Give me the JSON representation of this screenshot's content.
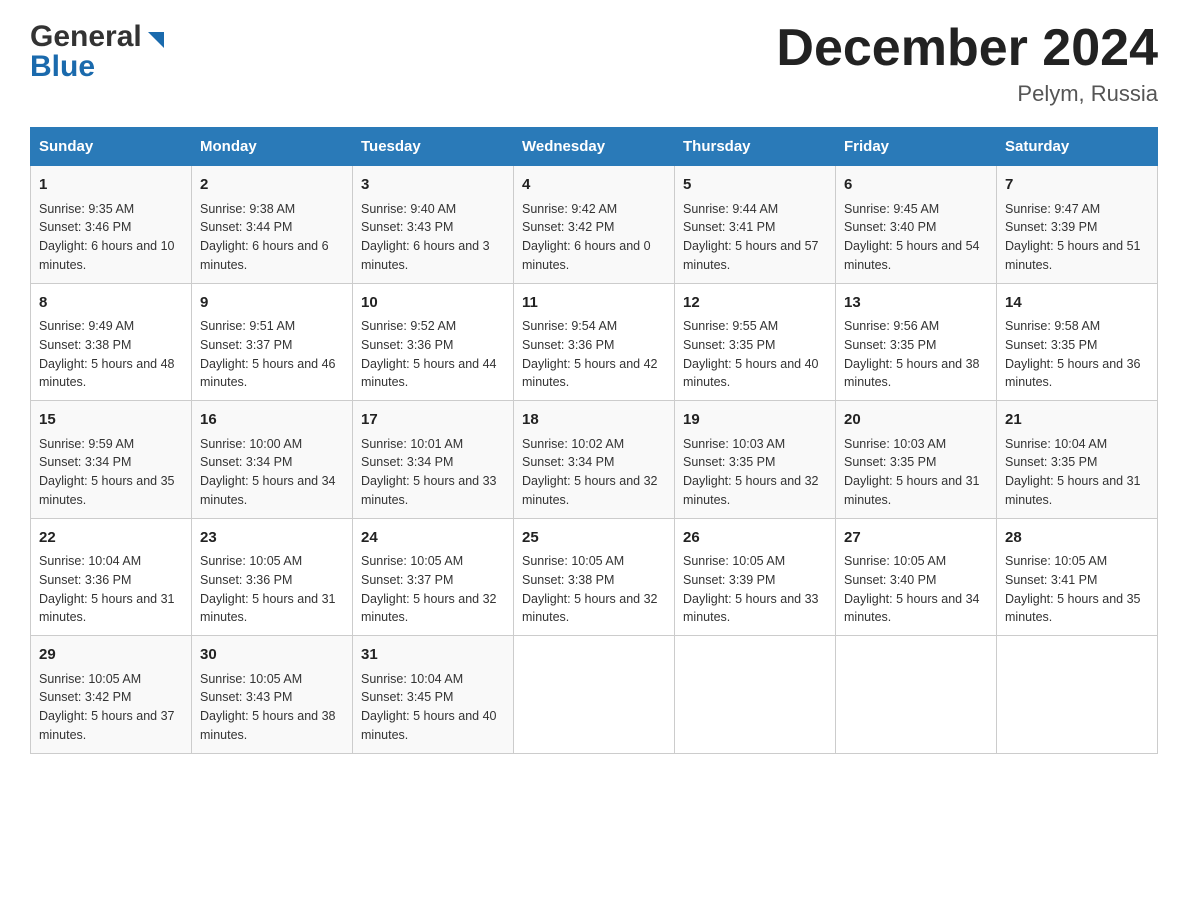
{
  "header": {
    "logo_general": "General",
    "logo_blue": "Blue",
    "month_title": "December 2024",
    "location": "Pelym, Russia"
  },
  "days_of_week": [
    "Sunday",
    "Monday",
    "Tuesday",
    "Wednesday",
    "Thursday",
    "Friday",
    "Saturday"
  ],
  "weeks": [
    [
      {
        "day": "1",
        "sunrise": "9:35 AM",
        "sunset": "3:46 PM",
        "daylight": "6 hours and 10 minutes."
      },
      {
        "day": "2",
        "sunrise": "9:38 AM",
        "sunset": "3:44 PM",
        "daylight": "6 hours and 6 minutes."
      },
      {
        "day": "3",
        "sunrise": "9:40 AM",
        "sunset": "3:43 PM",
        "daylight": "6 hours and 3 minutes."
      },
      {
        "day": "4",
        "sunrise": "9:42 AM",
        "sunset": "3:42 PM",
        "daylight": "6 hours and 0 minutes."
      },
      {
        "day": "5",
        "sunrise": "9:44 AM",
        "sunset": "3:41 PM",
        "daylight": "5 hours and 57 minutes."
      },
      {
        "day": "6",
        "sunrise": "9:45 AM",
        "sunset": "3:40 PM",
        "daylight": "5 hours and 54 minutes."
      },
      {
        "day": "7",
        "sunrise": "9:47 AM",
        "sunset": "3:39 PM",
        "daylight": "5 hours and 51 minutes."
      }
    ],
    [
      {
        "day": "8",
        "sunrise": "9:49 AM",
        "sunset": "3:38 PM",
        "daylight": "5 hours and 48 minutes."
      },
      {
        "day": "9",
        "sunrise": "9:51 AM",
        "sunset": "3:37 PM",
        "daylight": "5 hours and 46 minutes."
      },
      {
        "day": "10",
        "sunrise": "9:52 AM",
        "sunset": "3:36 PM",
        "daylight": "5 hours and 44 minutes."
      },
      {
        "day": "11",
        "sunrise": "9:54 AM",
        "sunset": "3:36 PM",
        "daylight": "5 hours and 42 minutes."
      },
      {
        "day": "12",
        "sunrise": "9:55 AM",
        "sunset": "3:35 PM",
        "daylight": "5 hours and 40 minutes."
      },
      {
        "day": "13",
        "sunrise": "9:56 AM",
        "sunset": "3:35 PM",
        "daylight": "5 hours and 38 minutes."
      },
      {
        "day": "14",
        "sunrise": "9:58 AM",
        "sunset": "3:35 PM",
        "daylight": "5 hours and 36 minutes."
      }
    ],
    [
      {
        "day": "15",
        "sunrise": "9:59 AM",
        "sunset": "3:34 PM",
        "daylight": "5 hours and 35 minutes."
      },
      {
        "day": "16",
        "sunrise": "10:00 AM",
        "sunset": "3:34 PM",
        "daylight": "5 hours and 34 minutes."
      },
      {
        "day": "17",
        "sunrise": "10:01 AM",
        "sunset": "3:34 PM",
        "daylight": "5 hours and 33 minutes."
      },
      {
        "day": "18",
        "sunrise": "10:02 AM",
        "sunset": "3:34 PM",
        "daylight": "5 hours and 32 minutes."
      },
      {
        "day": "19",
        "sunrise": "10:03 AM",
        "sunset": "3:35 PM",
        "daylight": "5 hours and 32 minutes."
      },
      {
        "day": "20",
        "sunrise": "10:03 AM",
        "sunset": "3:35 PM",
        "daylight": "5 hours and 31 minutes."
      },
      {
        "day": "21",
        "sunrise": "10:04 AM",
        "sunset": "3:35 PM",
        "daylight": "5 hours and 31 minutes."
      }
    ],
    [
      {
        "day": "22",
        "sunrise": "10:04 AM",
        "sunset": "3:36 PM",
        "daylight": "5 hours and 31 minutes."
      },
      {
        "day": "23",
        "sunrise": "10:05 AM",
        "sunset": "3:36 PM",
        "daylight": "5 hours and 31 minutes."
      },
      {
        "day": "24",
        "sunrise": "10:05 AM",
        "sunset": "3:37 PM",
        "daylight": "5 hours and 32 minutes."
      },
      {
        "day": "25",
        "sunrise": "10:05 AM",
        "sunset": "3:38 PM",
        "daylight": "5 hours and 32 minutes."
      },
      {
        "day": "26",
        "sunrise": "10:05 AM",
        "sunset": "3:39 PM",
        "daylight": "5 hours and 33 minutes."
      },
      {
        "day": "27",
        "sunrise": "10:05 AM",
        "sunset": "3:40 PM",
        "daylight": "5 hours and 34 minutes."
      },
      {
        "day": "28",
        "sunrise": "10:05 AM",
        "sunset": "3:41 PM",
        "daylight": "5 hours and 35 minutes."
      }
    ],
    [
      {
        "day": "29",
        "sunrise": "10:05 AM",
        "sunset": "3:42 PM",
        "daylight": "5 hours and 37 minutes."
      },
      {
        "day": "30",
        "sunrise": "10:05 AM",
        "sunset": "3:43 PM",
        "daylight": "5 hours and 38 minutes."
      },
      {
        "day": "31",
        "sunrise": "10:04 AM",
        "sunset": "3:45 PM",
        "daylight": "5 hours and 40 minutes."
      },
      null,
      null,
      null,
      null
    ]
  ]
}
